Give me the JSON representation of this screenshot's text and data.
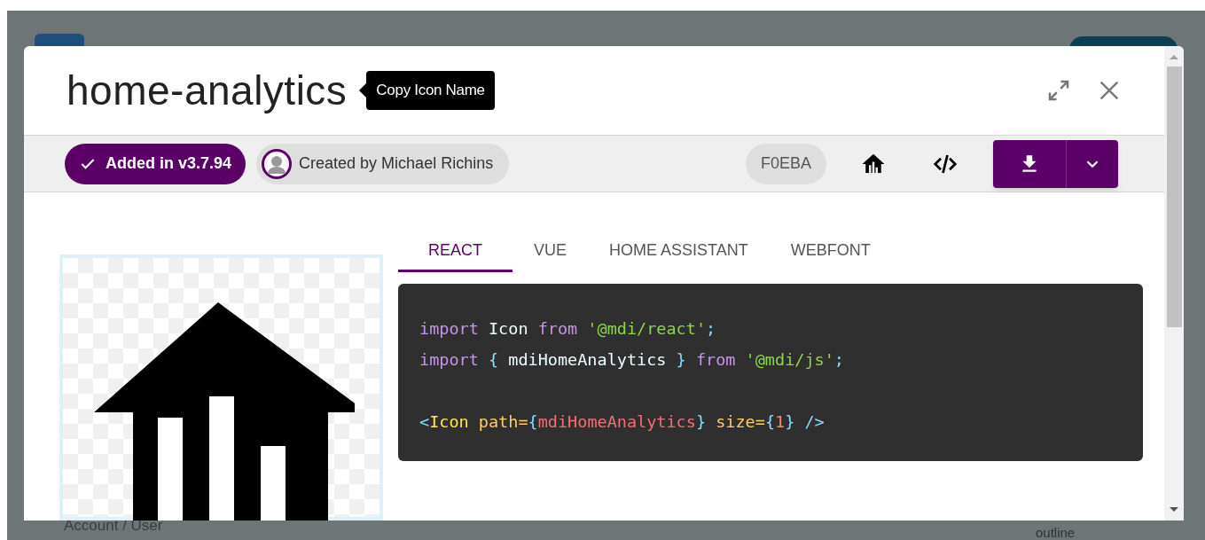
{
  "background": {
    "sidebar_item": "Account / User",
    "card_label": "outline"
  },
  "dialog": {
    "title": "home-analytics",
    "tooltip": "Copy Icon Name"
  },
  "toolbar": {
    "added": "Added in v3.7.94",
    "author": "Created by Michael Richins",
    "codepoint": "F0EBA"
  },
  "tabs": [
    {
      "label": "REACT",
      "selected": true
    },
    {
      "label": "VUE",
      "selected": false
    },
    {
      "label": "HOME ASSISTANT",
      "selected": false
    },
    {
      "label": "WEBFONT",
      "selected": false
    }
  ],
  "code_blocks": [
    [
      {
        "tokens": [
          {
            "text": "import",
            "kind": "keyword"
          },
          {
            "text": " Icon ",
            "kind": "plain"
          },
          {
            "text": "from ",
            "kind": "keyword"
          },
          {
            "text": "'@mdi/react'",
            "kind": "string"
          },
          {
            "text": ";",
            "kind": "punct"
          }
        ]
      },
      {
        "tokens": [
          {
            "text": "import ",
            "kind": "keyword"
          },
          {
            "text": "{",
            "kind": "punct"
          },
          {
            "text": " mdiHomeAnalytics ",
            "kind": "plain"
          },
          {
            "text": "} ",
            "kind": "punct"
          },
          {
            "text": "from ",
            "kind": "keyword"
          },
          {
            "text": "'@mdi/js'",
            "kind": "string"
          },
          {
            "text": ";",
            "kind": "punct"
          }
        ]
      }
    ],
    [
      {
        "tokens": [
          {
            "text": "<",
            "kind": "punct"
          },
          {
            "text": "Icon ",
            "kind": "tag"
          },
          {
            "text": "path",
            "kind": "attr"
          },
          {
            "text": "=",
            "kind": "attr"
          },
          {
            "text": "{",
            "kind": "punct"
          },
          {
            "text": "mdiHomeAnalytics",
            "kind": "variable"
          },
          {
            "text": "} ",
            "kind": "punct"
          },
          {
            "text": "size",
            "kind": "attr"
          },
          {
            "text": "=",
            "kind": "attr"
          },
          {
            "text": "{",
            "kind": "punct"
          },
          {
            "text": "1",
            "kind": "number"
          },
          {
            "text": "} ",
            "kind": "punct"
          },
          {
            "text": "/>",
            "kind": "punct"
          }
        ]
      }
    ]
  ]
}
